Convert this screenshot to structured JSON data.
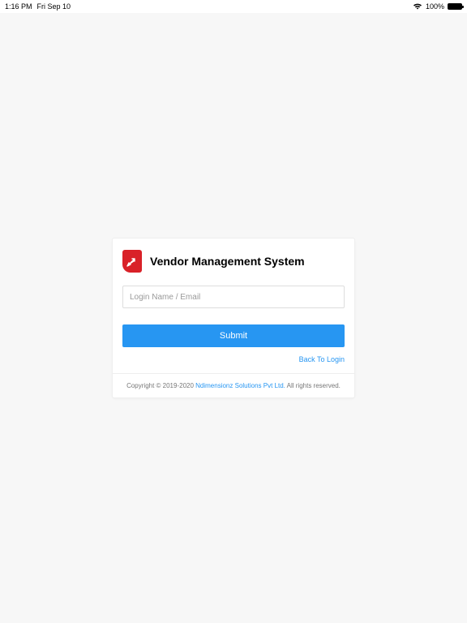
{
  "status_bar": {
    "time": "1:16 PM",
    "date": "Fri Sep 10",
    "battery_percent": "100%"
  },
  "card": {
    "title": "Vendor Management System",
    "login_placeholder": "Login Name / Email",
    "submit_label": "Submit",
    "back_link_label": "Back To Login"
  },
  "footer": {
    "prefix": "Copyright © 2019-2020 ",
    "company": "Ndimensionz Solutions Pvt Ltd.",
    "suffix": " All rights reserved."
  }
}
